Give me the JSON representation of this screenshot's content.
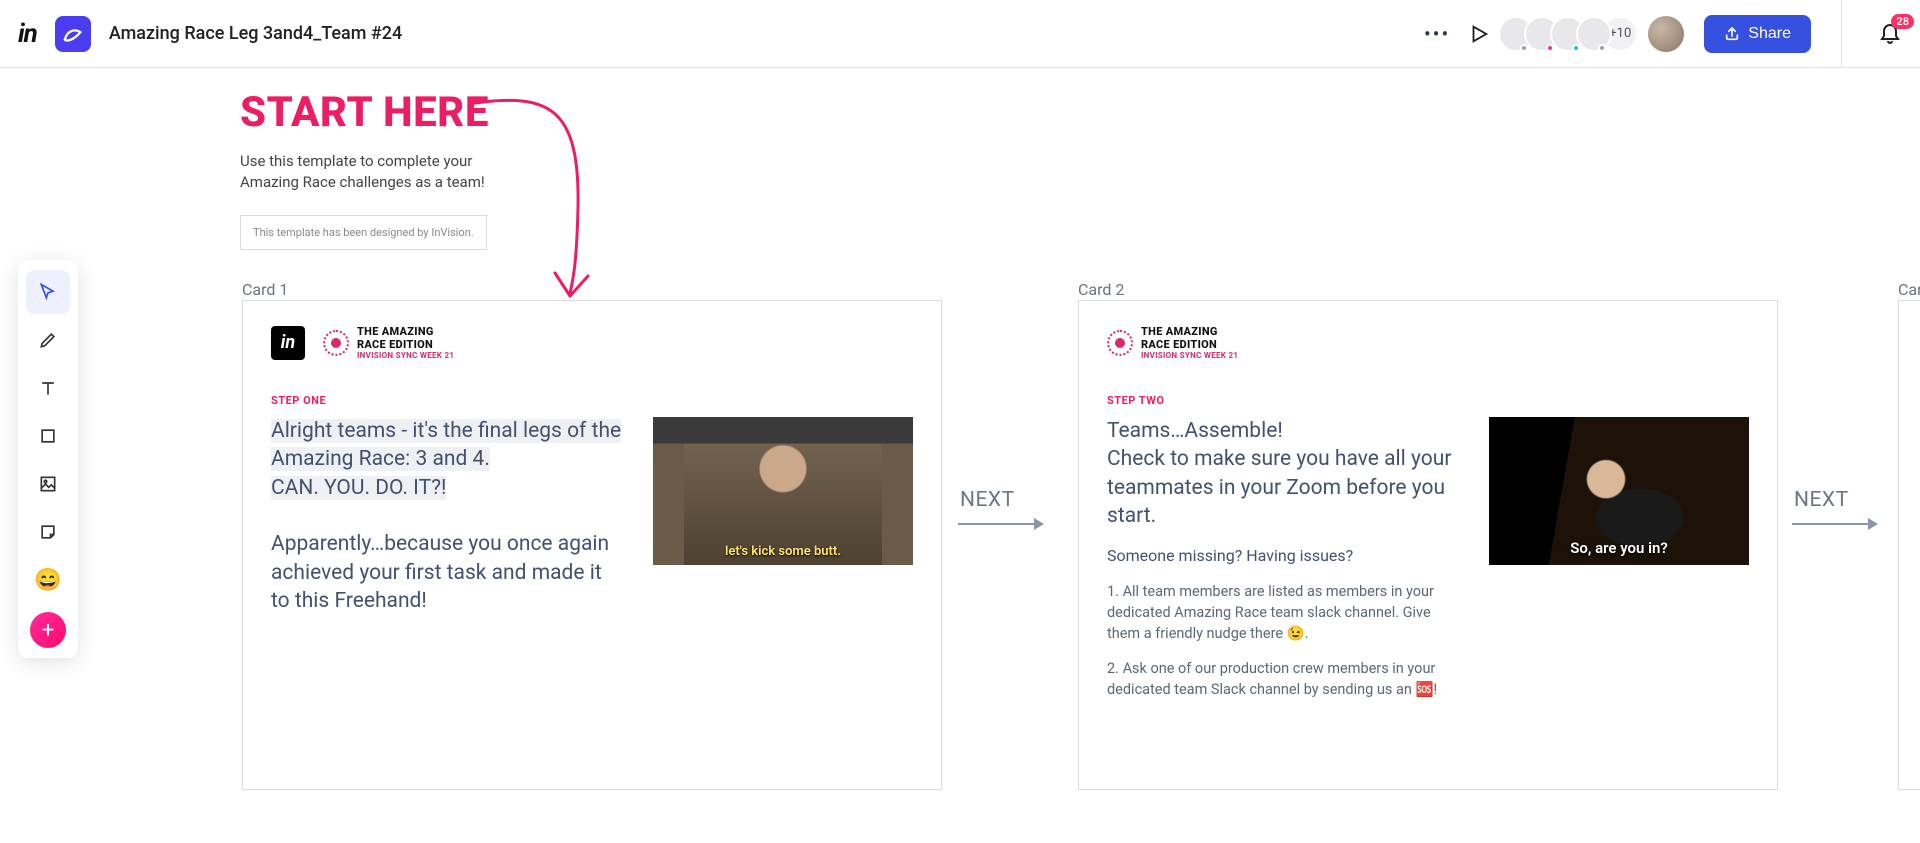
{
  "header": {
    "doc_title": "Amazing Race Leg 3and4_Team #24",
    "avatar_overflow": "+10",
    "share_label": "Share",
    "bell_count": "28"
  },
  "toolbar": {
    "emoji": "😄"
  },
  "start": {
    "title": "START HERE",
    "subtitle": "Use this template to complete your Amazing Race challenges as a team!",
    "badge": "This template has been designed by InVision."
  },
  "cards": {
    "card1": {
      "label": "Card 1",
      "race_line1": "THE AMAZING",
      "race_line2": "RACE EDITION",
      "race_sub": "INVISION SYNC WEEK 21",
      "step": "STEP ONE",
      "text_hl": "Alright teams - it's the final legs of the Amazing Race: 3 and 4.",
      "text_hl2": "CAN. YOU. DO. IT?!",
      "text_rest": "Apparently…because you once again achieved your first task and made it to this Freehand!",
      "media_caption": "let's kick some butt.",
      "next": "NEXT"
    },
    "card2": {
      "label": "Card 2",
      "race_line1": "THE AMAZING",
      "race_line2": "RACE EDITION",
      "race_sub": "INVISION SYNC WEEK 21",
      "step": "STEP TWO",
      "headline": "Teams…Assemble!\nCheck to make sure you have all your teammates in your Zoom before you start.",
      "subline": "Someone missing? Having issues?",
      "para1": "1. All team members are listed as members in your dedicated Amazing Race team slack channel. Give them a friendly nudge there 😉.",
      "para2": "2. Ask one of our production crew members in your dedicated team Slack channel by sending us an 🆘!",
      "media_caption": "So, are you in?",
      "next": "NEXT"
    },
    "card3": {
      "label": "Car"
    }
  }
}
